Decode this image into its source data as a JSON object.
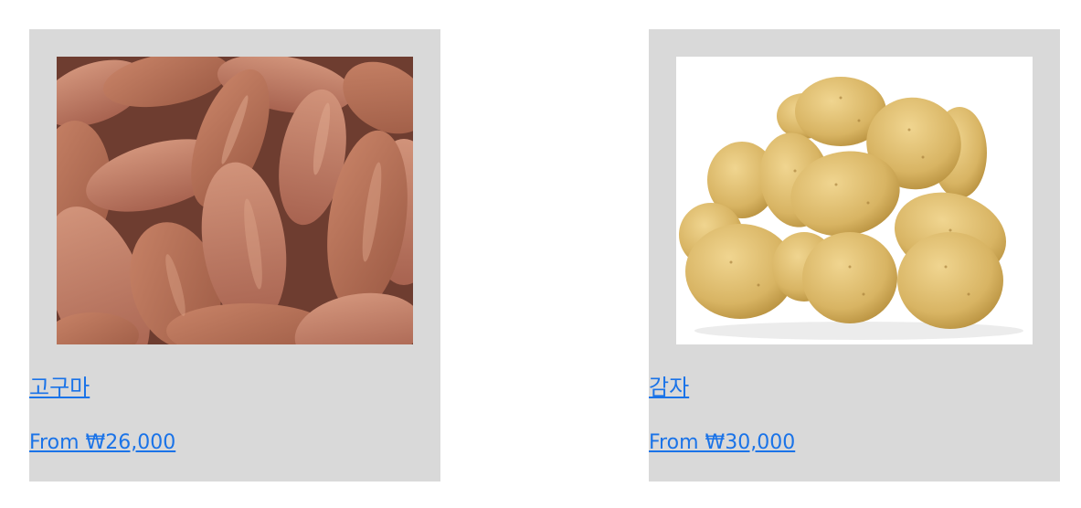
{
  "products": [
    {
      "name": "고구마",
      "price": "From ₩26,000",
      "image_icon": "sweet-potato-image"
    },
    {
      "name": "감자",
      "price": "From ₩30,000",
      "image_icon": "potato-image"
    }
  ],
  "colors": {
    "card_background": "#d9d9d9",
    "link": "#1a73e8",
    "sweet_potato_skin": "#b86a4e",
    "potato_skin": "#d9b86a"
  }
}
